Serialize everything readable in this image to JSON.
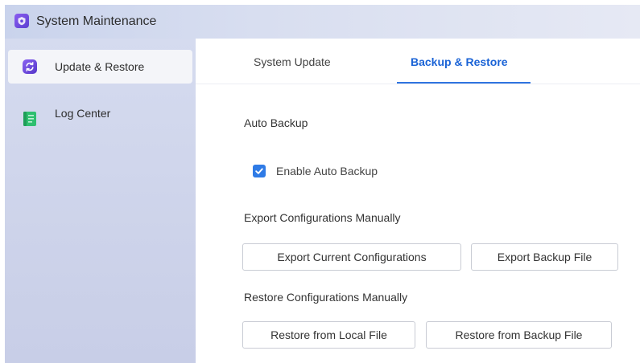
{
  "window": {
    "title": "System Maintenance",
    "app_icon": "shield-app-icon"
  },
  "sidebar": {
    "items": [
      {
        "label": "Update & Restore",
        "icon": "refresh-icon",
        "active": true
      },
      {
        "label": "Log Center",
        "icon": "notebook-icon",
        "active": false
      }
    ]
  },
  "tabs": [
    {
      "label": "System Update",
      "active": false
    },
    {
      "label": "Backup & Restore",
      "active": true
    }
  ],
  "auto_backup": {
    "title": "Auto Backup",
    "checkbox_label": "Enable Auto Backup",
    "checked": true
  },
  "export": {
    "title": "Export Configurations Manually",
    "buttons": [
      "Export Current Configurations",
      "Export Backup File"
    ]
  },
  "restore": {
    "title": "Restore Configurations Manually",
    "buttons": [
      "Restore from Local File",
      "Restore from Backup File"
    ]
  },
  "colors": {
    "accent": "#2f74e0",
    "checkbox": "#2f7be6"
  }
}
